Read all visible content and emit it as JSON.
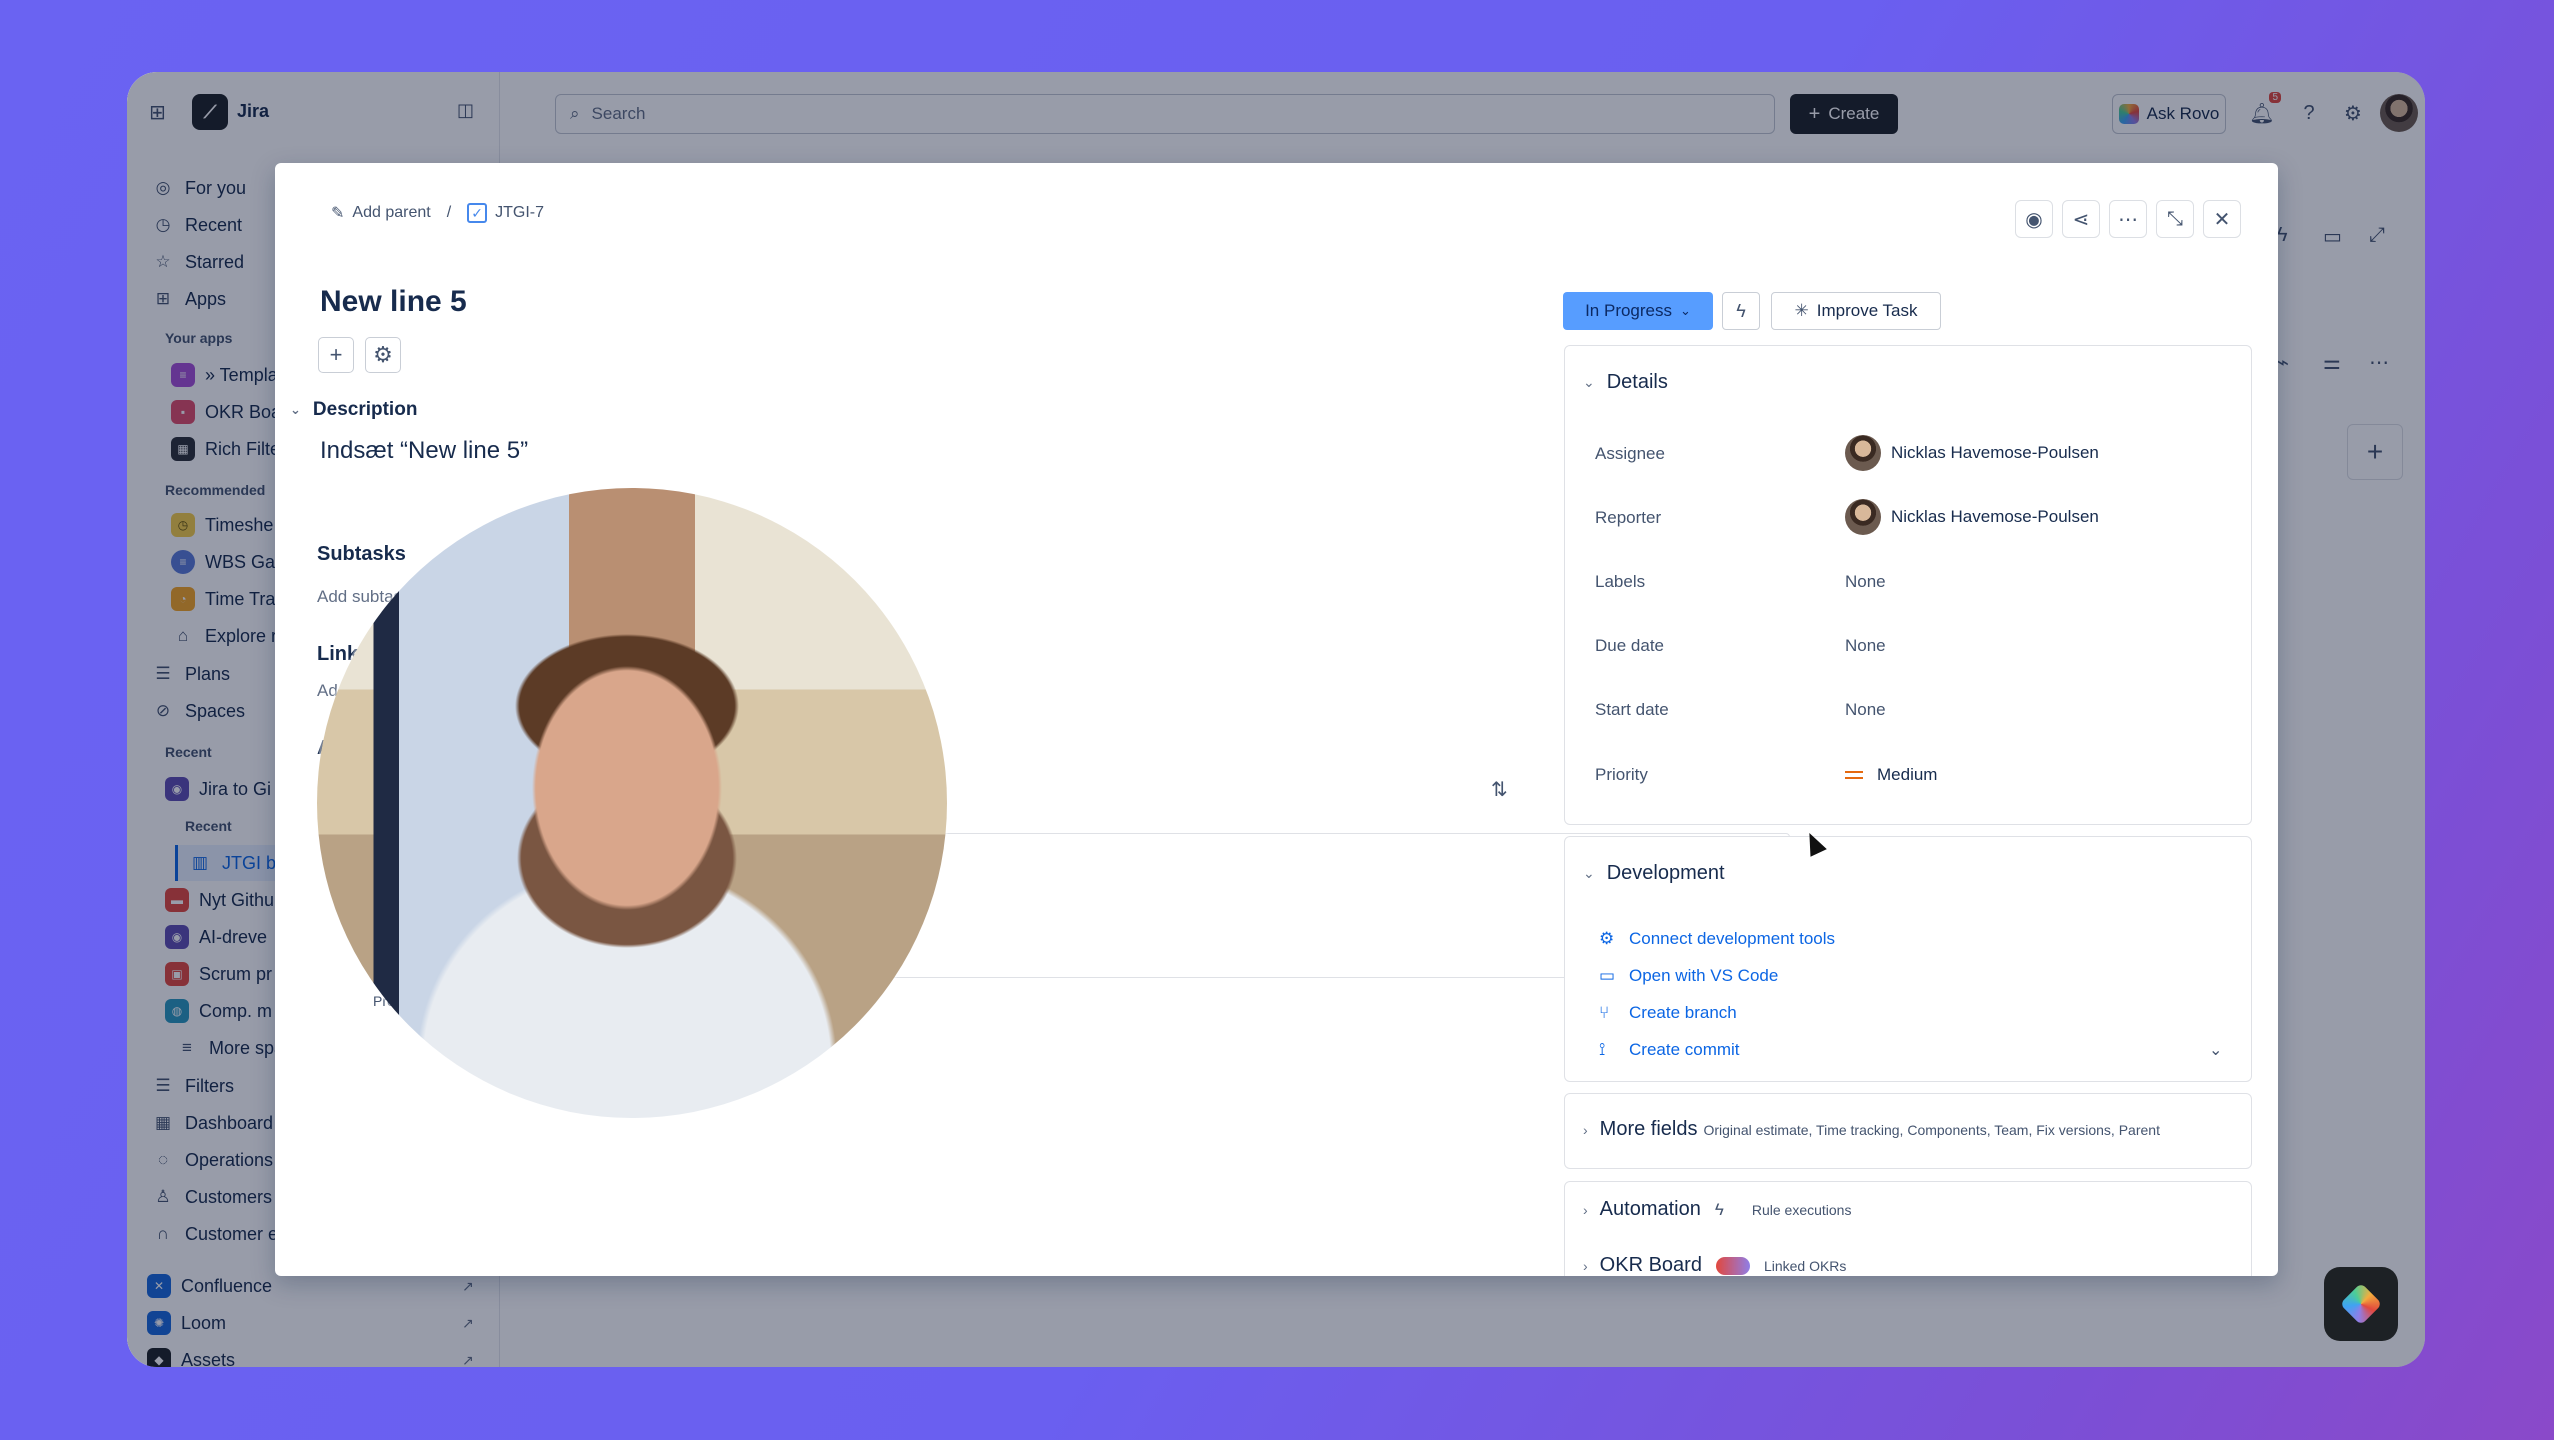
{
  "app": {
    "name": "Jira",
    "search_placeholder": "Search",
    "create_label": "Create",
    "ask_rovo_label": "Ask Rovo",
    "notification_count": "5"
  },
  "sidebar": {
    "items": [
      {
        "label": "For you",
        "icon": "target-icon"
      },
      {
        "label": "Recent",
        "icon": "clock-icon"
      },
      {
        "label": "Starred",
        "icon": "star-icon"
      },
      {
        "label": "Apps",
        "icon": "apps-icon"
      }
    ],
    "your_apps_heading": "Your apps",
    "your_apps": [
      {
        "label": "» Templa",
        "color": "#a54fd6"
      },
      {
        "label": "OKR Boa",
        "color": "#e04c6a"
      },
      {
        "label": "Rich Filte",
        "color": "#2b2f36"
      }
    ],
    "recommended_heading": "Recommended",
    "recommended": [
      {
        "label": "Timeshe",
        "color": "#f5cd47"
      },
      {
        "label": "WBS Gar",
        "color": "#5b7bd8"
      },
      {
        "label": "Time Tra",
        "color": "#f5a524"
      },
      {
        "label": "Explore r",
        "color": "#44546f"
      }
    ],
    "plans_label": "Plans",
    "spaces_label": "Spaces",
    "recent_heading": "Recent",
    "recent_space": "Jira to Gi",
    "recent_sub_heading": "Recent",
    "recent_board": "JTGI b",
    "spaces": [
      {
        "label": "Nyt Githu",
        "color": "#e2483d"
      },
      {
        "label": "AI-dreve",
        "color": "#5e4db2"
      },
      {
        "label": "Scrum pr",
        "color": "#e2483d"
      },
      {
        "label": "Comp. m",
        "color": "#2898bd"
      }
    ],
    "more_spaces_label": "More spa",
    "bottom_items": [
      {
        "label": "Filters",
        "icon": "filter-icon"
      },
      {
        "label": "Dashboard",
        "icon": "dashboard-icon"
      },
      {
        "label": "Operations",
        "icon": "operations-icon"
      },
      {
        "label": "Customers",
        "icon": "customers-icon"
      },
      {
        "label": "Customer e",
        "icon": "headset-icon"
      }
    ],
    "products": [
      {
        "label": "Confluence",
        "color": "#1868db"
      },
      {
        "label": "Loom",
        "color": "#1868db"
      },
      {
        "label": "Assets",
        "color": "#1d2125"
      }
    ]
  },
  "issue": {
    "breadcrumb_add_parent": "Add parent",
    "breadcrumb_separator": "/",
    "key": "JTGI-7",
    "title": "New line 5",
    "description_heading": "Description",
    "description_text": "Indsæt “New line 5”",
    "subtasks_heading": "Subtasks",
    "add_subtask_label": "Add subtask",
    "linked_heading": "Linke",
    "add_linked_label": "Add",
    "activity_heading": "Ac",
    "pro_tip_label": "Pro t"
  },
  "status": {
    "label": "In Progress",
    "color": "#579dff",
    "improve_label": "Improve Task"
  },
  "details": {
    "heading": "Details",
    "fields": [
      {
        "label": "Assignee",
        "value": "Nicklas Havemose-Poulsen",
        "avatar": true
      },
      {
        "label": "Reporter",
        "value": "Nicklas Havemose-Poulsen",
        "avatar": true
      },
      {
        "label": "Labels",
        "value": "None"
      },
      {
        "label": "Due date",
        "value": "None"
      },
      {
        "label": "Start date",
        "value": "None"
      },
      {
        "label": "Priority",
        "value": "Medium",
        "priority_icon": "priority-medium-icon",
        "priority_color": "#e56910"
      }
    ]
  },
  "development": {
    "heading": "Development",
    "links": [
      {
        "label": "Connect development tools",
        "icon": "gear-icon"
      },
      {
        "label": "Open with VS Code",
        "icon": "monitor-icon"
      },
      {
        "label": "Create branch",
        "icon": "branch-icon"
      },
      {
        "label": "Create commit",
        "icon": "commit-icon"
      }
    ]
  },
  "more_fields": {
    "heading": "More fields",
    "subtitle": "Original estimate, Time tracking, Components, Team, Fix versions, Parent"
  },
  "automation": {
    "heading": "Automation",
    "subtitle": "Rule executions"
  },
  "okr_board": {
    "heading": "OKR Board",
    "subtitle": "Linked OKRs"
  }
}
